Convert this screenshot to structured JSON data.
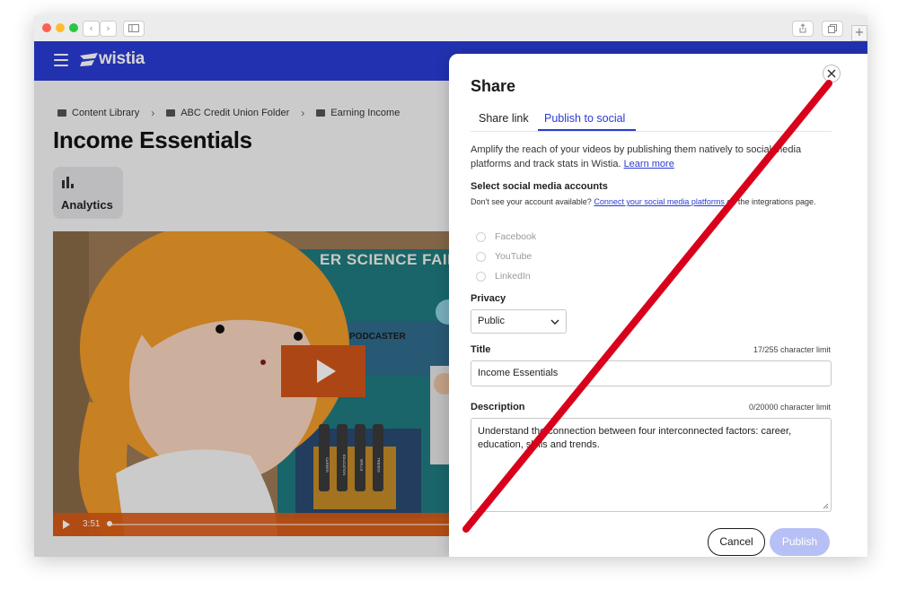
{
  "app": {
    "logo_text": "wistia",
    "breadcrumb": [
      "Content Library",
      "ABC Credit Union Folder",
      "Earning Income"
    ],
    "page_title": "Income Essentials",
    "analytics_label": "Analytics",
    "video": {
      "time": "3:51",
      "scene_text": "ER SCIENCE FAIR",
      "booth_text": "PODCASTER",
      "jars": [
        "CAREER",
        "EDUCATION",
        "SKILLS",
        "TRENDS"
      ]
    }
  },
  "modal": {
    "title": "Share",
    "tabs": [
      {
        "label": "Share link",
        "active": false
      },
      {
        "label": "Publish to social",
        "active": true
      }
    ],
    "intro_text": "Amplify the reach of your videos by publishing them natively to social media platforms and track stats in Wistia.",
    "learn_more": "Learn more",
    "accounts_label": "Select social media accounts",
    "help_prefix": "Don't see your account available?",
    "help_link": "Connect your social media platforms",
    "help_suffix": "on the integrations page.",
    "accounts": [
      "Facebook",
      "YouTube",
      "LinkedIn"
    ],
    "privacy_label": "Privacy",
    "privacy_value": "Public",
    "title_label": "Title",
    "title_limit": "17/255 character limit",
    "title_value": "Income Essentials",
    "description_label": "Description",
    "description_limit": "0/20000 character limit",
    "description_value": "Understand the connection between four interconnected factors: career, education, skills and trends.",
    "cancel_label": "Cancel",
    "publish_label": "Publish"
  },
  "colors": {
    "brand": "#2a3bd4",
    "publish_disabled": "#b7c0f5",
    "video_accent": "#e26a1f",
    "slash": "#d9001b"
  }
}
